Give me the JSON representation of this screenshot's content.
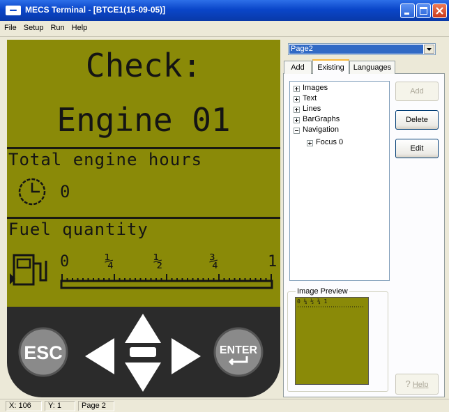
{
  "window": {
    "title": "MECS Terminal - [BTCE1(15-09-05)]",
    "app_icon": "terminal-logo"
  },
  "menu": [
    "File",
    "Setup",
    "Run",
    "Help"
  ],
  "lcd": {
    "heading": "Check:",
    "subheading": "Engine 01",
    "section1_label": "Total engine hours",
    "engine_hours": "0",
    "section2_label": "Fuel quantity",
    "scale": [
      "0",
      "¼",
      "½",
      "¾",
      "1"
    ]
  },
  "keypad": {
    "esc": "ESC",
    "enter": "ENTER"
  },
  "panel": {
    "page_select": "Page2",
    "tabs": [
      "Add",
      "Existing",
      "Languages"
    ],
    "active_tab": "Existing",
    "tree": [
      "Images",
      "Text",
      "Lines",
      "BarGraphs",
      "Navigation",
      "Focus 0"
    ],
    "buttons": {
      "add": "Add",
      "delete": "Delete",
      "edit": "Edit",
      "help": "Help"
    },
    "preview_label": "Image Preview",
    "preview_scale": "0  ¼  ½  ¾  1"
  },
  "status": {
    "x": "X: 106",
    "y": "Y: 1",
    "page": "Page 2"
  },
  "colors": {
    "lcd": "#8a8a08",
    "lcd_ink": "#141414",
    "titlebar": "#0a46c9",
    "tab_highlight": "#f8b83a"
  }
}
